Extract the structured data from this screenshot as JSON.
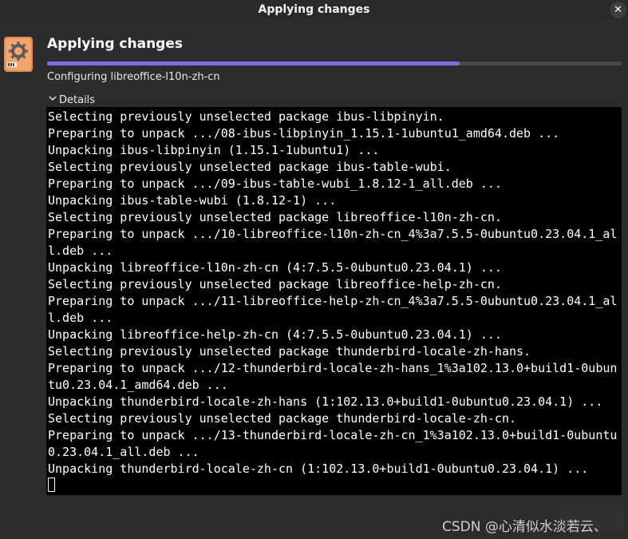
{
  "window": {
    "title": "Applying changes",
    "close_label": "✕"
  },
  "header": {
    "title": "Applying changes"
  },
  "progress": {
    "fraction": 0.718,
    "color": "#7b6ee6"
  },
  "status": {
    "text": "Configuring libreoffice-l10n-zh-cn"
  },
  "details": {
    "label": "Details",
    "expanded": true
  },
  "terminal": {
    "lines": [
      "Selecting previously unselected package ibus-libpinyin.",
      "Preparing to unpack .../08-ibus-libpinyin_1.15.1-1ubuntu1_amd64.deb ...",
      "Unpacking ibus-libpinyin (1.15.1-1ubuntu1) ...",
      "Selecting previously unselected package ibus-table-wubi.",
      "Preparing to unpack .../09-ibus-table-wubi_1.8.12-1_all.deb ...",
      "Unpacking ibus-table-wubi (1.8.12-1) ...",
      "Selecting previously unselected package libreoffice-l10n-zh-cn.",
      "Preparing to unpack .../10-libreoffice-l10n-zh-cn_4%3a7.5.5-0ubuntu0.23.04.1_al",
      "l.deb ...",
      "Unpacking libreoffice-l10n-zh-cn (4:7.5.5-0ubuntu0.23.04.1) ...",
      "Selecting previously unselected package libreoffice-help-zh-cn.",
      "Preparing to unpack .../11-libreoffice-help-zh-cn_4%3a7.5.5-0ubuntu0.23.04.1_al",
      "l.deb ...",
      "Unpacking libreoffice-help-zh-cn (4:7.5.5-0ubuntu0.23.04.1) ...",
      "Selecting previously unselected package thunderbird-locale-zh-hans.",
      "Preparing to unpack .../12-thunderbird-locale-zh-hans_1%3a102.13.0+build1-0ubun",
      "tu0.23.04.1_amd64.deb ...",
      "Unpacking thunderbird-locale-zh-hans (1:102.13.0+build1-0ubuntu0.23.04.1) ...",
      "Selecting previously unselected package thunderbird-locale-zh-cn.",
      "Preparing to unpack .../13-thunderbird-locale-zh-cn_1%3a102.13.0+build1-0ubuntu",
      "0.23.04.1_all.deb ...",
      "Unpacking thunderbird-locale-zh-cn (1:102.13.0+build1-0ubuntu0.23.04.1) ..."
    ]
  },
  "watermark": {
    "text": "CSDN @心清似水淡若云、"
  },
  "icons": {
    "app": "software-updater-icon",
    "chevron": "chevron-down-icon",
    "close": "close-icon"
  }
}
